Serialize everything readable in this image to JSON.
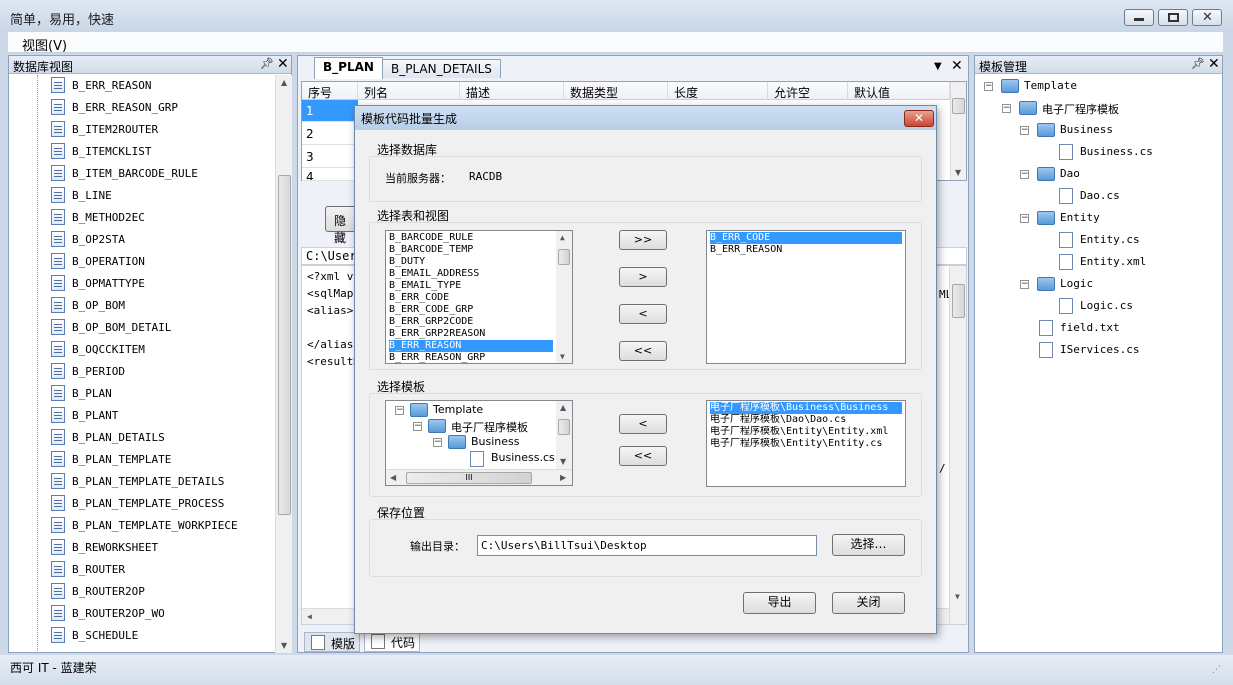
{
  "window": {
    "title": "简单，易用，快速"
  },
  "menu": {
    "view": "视图(V)"
  },
  "left_panel": {
    "title": "数据库视图",
    "items": [
      "B_ERR_REASON",
      "B_ERR_REASON_GRP",
      "B_ITEM2ROUTER",
      "B_ITEMCKLIST",
      "B_ITEM_BARCODE_RULE",
      "B_LINE",
      "B_METHOD2EC",
      "B_OP2STA",
      "B_OPERATION",
      "B_OPMATTYPE",
      "B_OP_BOM",
      "B_OP_BOM_DETAIL",
      "B_OQCCKITEM",
      "B_PERIOD",
      "B_PLAN",
      "B_PLANT",
      "B_PLAN_DETAILS",
      "B_PLAN_TEMPLATE",
      "B_PLAN_TEMPLATE_DETAILS",
      "B_PLAN_TEMPLATE_PROCESS",
      "B_PLAN_TEMPLATE_WORKPIECE",
      "B_REWORKSHEET",
      "B_ROUTER",
      "B_ROUTER2OP",
      "B_ROUTER2OP_WO",
      "B_SCHEDULE"
    ]
  },
  "center": {
    "tabs": [
      "B_PLAN",
      "B_PLAN_DETAILS"
    ],
    "grid_headers": [
      "序号",
      "列名",
      "描述",
      "数据类型",
      "长度",
      "允许空",
      "默认值"
    ],
    "grid_rows": [
      "1",
      "2",
      "3",
      "4"
    ],
    "hide_button": "隐藏",
    "path": "C:\\Users",
    "code_lines": [
      "<?xml ve",
      "<sqlMap ",
      "<alias>",
      "",
      "</alias>",
      "<resultM"
    ],
    "code_right_fragments": [
      "ML",
      "/"
    ],
    "bottom_tabs": [
      "模版",
      "代码"
    ]
  },
  "right_panel": {
    "title": "模板管理",
    "tree": [
      {
        "label": "Template",
        "type": "folder",
        "level": 0
      },
      {
        "label": "电子厂程序模板",
        "type": "folder",
        "level": 1
      },
      {
        "label": "Business",
        "type": "folder",
        "level": 2
      },
      {
        "label": "Business.cs",
        "type": "file",
        "level": 3
      },
      {
        "label": "Dao",
        "type": "folder",
        "level": 2
      },
      {
        "label": "Dao.cs",
        "type": "file",
        "level": 3
      },
      {
        "label": "Entity",
        "type": "folder",
        "level": 2
      },
      {
        "label": "Entity.cs",
        "type": "file",
        "level": 3
      },
      {
        "label": "Entity.xml",
        "type": "file",
        "level": 3
      },
      {
        "label": "Logic",
        "type": "folder",
        "level": 2
      },
      {
        "label": "Logic.cs",
        "type": "file",
        "level": 3
      },
      {
        "label": "field.txt",
        "type": "file",
        "level": 2
      },
      {
        "label": "IServices.cs",
        "type": "file",
        "level": 2
      }
    ]
  },
  "status": {
    "text": "西可 IT - 蓝建荣"
  },
  "dialog": {
    "title": "模板代码批量生成",
    "close": "✕",
    "db_group": "选择数据库",
    "server_label": "当前服务器：",
    "server_value": "RACDB",
    "tables_group": "选择表和视图",
    "source_tables": [
      "B_BARCODE_RULE",
      "B_BARCODE_TEMP",
      "B_DUTY",
      "B_EMAIL_ADDRESS",
      "B_EMAIL_TYPE",
      "B_ERR_CODE",
      "B_ERR_CODE_GRP",
      "B_ERR_GRP2CODE",
      "B_ERR_GRP2REASON",
      "B_ERR_REASON",
      "B_ERR_REASON_GRP"
    ],
    "source_selected_index": 9,
    "selected_tables": [
      "B_ERR_CODE",
      "B_ERR_REASON"
    ],
    "selected_tables_highlight": 0,
    "move_buttons": [
      ">>",
      ">",
      "<",
      "<<"
    ],
    "template_group": "选择模板",
    "template_tree": [
      "Template",
      "电子厂程序模板",
      "Business",
      "Business.cs"
    ],
    "template_scroll_glyph": "III",
    "selected_templates": [
      "电子厂程序模板\\Business\\Business",
      "电子厂程序模板\\Dao\\Dao.cs",
      "电子厂程序模板\\Entity\\Entity.xml",
      "电子厂程序模板\\Entity\\Entity.cs"
    ],
    "template_buttons": [
      "<",
      "<<"
    ],
    "save_group": "保存位置",
    "output_label": "输出目录：",
    "output_value": "C:\\Users\\BillTsui\\Desktop",
    "choose_button": "选择…",
    "export_button": "导出",
    "close_button": "关闭"
  }
}
